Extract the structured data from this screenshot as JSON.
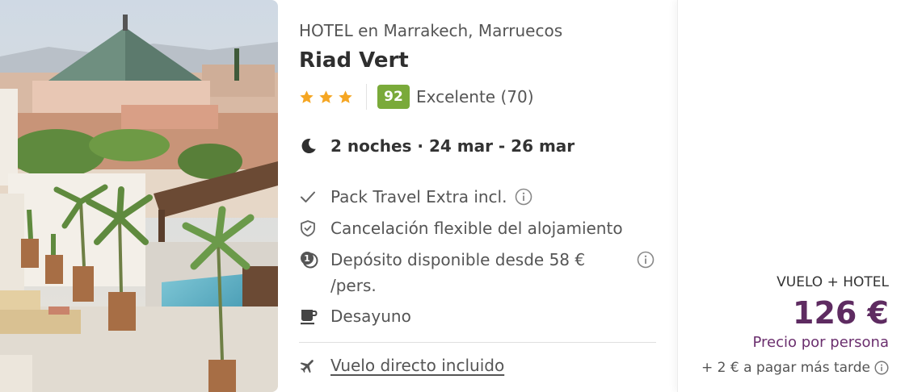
{
  "hotel": {
    "kicker": "HOTEL en Marrakech, Marruecos",
    "name": "Riad Vert",
    "stars": 3,
    "score": "92",
    "score_text": "Excelente (70)"
  },
  "stay": {
    "text": "2 noches · 24 mar - 26 mar"
  },
  "features": [
    {
      "icon": "check-icon",
      "label": "Pack Travel Extra incl."
    },
    {
      "icon": "shield-check-icon",
      "label": "Cancelación flexible del alojamiento"
    },
    {
      "icon": "deposit-coin-icon",
      "label": "Depósito disponible desde 58 € /pers."
    },
    {
      "icon": "coffee-cup-icon",
      "label": "Desayuno"
    },
    {
      "icon": "airplane-icon",
      "label": "Vuelo directo incluido"
    }
  ],
  "price": {
    "type": "VUELO + HOTEL",
    "value": "126 €",
    "per": "Precio por persona",
    "extra": "+ 2 € a pagar más tarde"
  },
  "colors": {
    "score_bg": "#7aaa3a",
    "star": "#f5a623",
    "price": "#5e2b61"
  }
}
